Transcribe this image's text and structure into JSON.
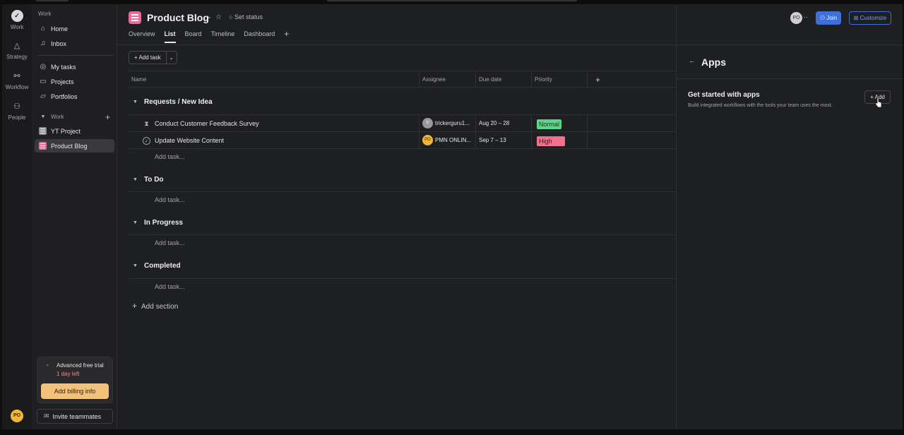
{
  "rail": {
    "items": [
      {
        "label": "Work",
        "icon": "check-circle-icon"
      },
      {
        "label": "Strategy",
        "icon": "triangle-icon"
      },
      {
        "label": "Workflow",
        "icon": "workflow-icon"
      },
      {
        "label": "People",
        "icon": "people-icon"
      }
    ],
    "avatar": "PO"
  },
  "sidebar": {
    "work_heading": "Work",
    "nav": [
      {
        "label": "Home",
        "icon": "home-icon"
      },
      {
        "label": "Inbox",
        "icon": "bell-icon"
      },
      {
        "label": "My tasks",
        "icon": "check-circle-icon"
      },
      {
        "label": "Projects",
        "icon": "clipboard-icon"
      },
      {
        "label": "Portfolios",
        "icon": "folder-icon"
      }
    ],
    "team_heading": "Work",
    "projects": [
      {
        "label": "YT Project",
        "color": "#d9d9db"
      },
      {
        "label": "Product Blog",
        "color": "#f06a99"
      }
    ],
    "trial": {
      "title": "Advanced free trial",
      "sub": "1 day left",
      "button": "Add billing info"
    },
    "invite": "Invite teammates"
  },
  "header": {
    "title": "Product Blog",
    "set_status": "Set status",
    "tabs": [
      "Overview",
      "List",
      "Board",
      "Timeline",
      "Dashboard"
    ],
    "active_tab": "List"
  },
  "toolbar": {
    "add_task": "Add task"
  },
  "columns": [
    "Name",
    "Assignee",
    "Due date",
    "Priority"
  ],
  "sections": [
    {
      "title": "Requests / New Idea",
      "tasks": [
        {
          "name": "Conduct Customer Feedback Survey",
          "assignee_initials": "tr",
          "assignee": "trickerguru1...",
          "due": "Aug 20 – 28",
          "priority": "Normal"
        },
        {
          "name": "Update Website Content",
          "assignee_initials": "PO",
          "assignee": "PMN ONLIN...",
          "due": "Sep 7 – 13",
          "priority": "High"
        }
      ]
    },
    {
      "title": "To Do",
      "tasks": []
    },
    {
      "title": "In Progress",
      "tasks": []
    },
    {
      "title": "Completed",
      "tasks": []
    }
  ],
  "add_task_placeholder": "Add task...",
  "add_section": "Add section",
  "panel": {
    "avatar": "PO",
    "join": "Join",
    "customize": "Customize",
    "title": "Apps",
    "heading": "Get started with apps",
    "description": "Build integrated workflows with the tools your team uses the most.",
    "add": "Add"
  },
  "colors": {
    "normal_badge": "#5ed38a",
    "high_badge": "#f0708e",
    "accent_blue": "#3f6fd8",
    "billing": "#f2c27a"
  }
}
